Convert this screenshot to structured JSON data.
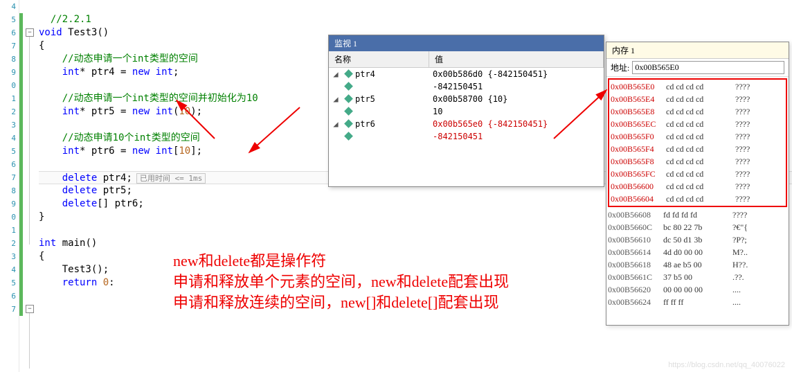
{
  "editor": {
    "line_numbers": [
      "4",
      "5",
      "6",
      "7",
      "8",
      "9",
      "0",
      "1",
      "2",
      "3",
      "4",
      "5",
      "6",
      "7",
      "8",
      "9",
      "0",
      "1",
      "2",
      "3",
      "4",
      "5",
      "6",
      "7"
    ],
    "comment_section": "//2.2.1",
    "func_decl": {
      "kw": "void",
      "name": "Test3",
      "paren": "()"
    },
    "brace_open": "{",
    "c1": "//动态申请一个",
    "c1_type": "int",
    "c1_tail": "类型的空间",
    "l1": {
      "type": "int",
      "star": "*",
      "var": "ptr4",
      "eq": " = ",
      "kw": "new",
      "sp": " ",
      "t2": "int",
      "end": ";"
    },
    "c2": "//动态申请一个",
    "c2_type": "int",
    "c2_tail": "类型的空间并初始化为10",
    "l2": {
      "type": "int",
      "star": "*",
      "var": "ptr5",
      "eq": " = ",
      "kw": "new",
      "sp": " ",
      "t2": "int",
      "lp": "(",
      "num": "10",
      "rp": ")",
      "end": ";"
    },
    "c3": "//动态申请10个",
    "c3_type": "int",
    "c3_tail": "类型的空间",
    "l3": {
      "type": "int",
      "star": "*",
      "var": "ptr6",
      "eq": " = ",
      "kw": "new",
      "sp": " ",
      "t2": "int",
      "lb": "[",
      "num": "10",
      "rb": "]",
      "end": ";"
    },
    "d1": {
      "kw": "delete",
      "sp": " ",
      "var": "ptr4",
      "end": ";"
    },
    "perf_label": "已用时间 <= 1ms",
    "d2": {
      "kw": "delete",
      "sp": " ",
      "var": "ptr5",
      "end": ";"
    },
    "d3": {
      "kw": "delete",
      "br": "[] ",
      "var": "ptr6",
      "end": ";"
    },
    "brace_close": "}",
    "main_decl": {
      "type": "int",
      "name": "main",
      "paren": "()"
    },
    "main_body_call": "Test3();",
    "main_return": {
      "kw": "return",
      "sp": " ",
      "num": "0",
      "end": ":"
    }
  },
  "watch": {
    "title": "监视 1",
    "hdr_name": "名称",
    "hdr_value": "值",
    "rows": [
      {
        "exp": "◢",
        "icon": true,
        "name": "ptr4",
        "value": "0x00b586d0 {-842150451}"
      },
      {
        "exp": "",
        "icon": true,
        "name": "",
        "value": "-842150451",
        "child": true
      },
      {
        "exp": "◢",
        "icon": true,
        "name": "ptr5",
        "value": "0x00b58700 {10}"
      },
      {
        "exp": "",
        "icon": true,
        "name": "",
        "value": "10",
        "child": true
      },
      {
        "exp": "◢",
        "icon": true,
        "name": "ptr6",
        "value": "0x00b565e0 {-842150451}",
        "red": true
      },
      {
        "exp": "",
        "icon": true,
        "name": "",
        "value": "-842150451",
        "child": true,
        "red": true
      }
    ]
  },
  "memory": {
    "title": "内存 1",
    "addr_label": "地址:",
    "addr_value": "0x00B565E0",
    "highlighted": [
      {
        "a": "0x00B565E0",
        "h": "cd cd cd cd",
        "t": "????"
      },
      {
        "a": "0x00B565E4",
        "h": "cd cd cd cd",
        "t": "????"
      },
      {
        "a": "0x00B565E8",
        "h": "cd cd cd cd",
        "t": "????"
      },
      {
        "a": "0x00B565EC",
        "h": "cd cd cd cd",
        "t": "????"
      },
      {
        "a": "0x00B565F0",
        "h": "cd cd cd cd",
        "t": "????"
      },
      {
        "a": "0x00B565F4",
        "h": "cd cd cd cd",
        "t": "????"
      },
      {
        "a": "0x00B565F8",
        "h": "cd cd cd cd",
        "t": "????"
      },
      {
        "a": "0x00B565FC",
        "h": "cd cd cd cd",
        "t": "????"
      },
      {
        "a": "0x00B56600",
        "h": "cd cd cd cd",
        "t": "????"
      },
      {
        "a": "0x00B56604",
        "h": "cd cd cd cd",
        "t": "????"
      }
    ],
    "rest": [
      {
        "a": "0x00B56608",
        "h": "fd fd fd fd",
        "t": "????"
      },
      {
        "a": "0x00B5660C",
        "h": "bc 80 22 7b",
        "t": "?€\"{"
      },
      {
        "a": "0x00B56610",
        "h": "dc 50 d1 3b",
        "t": "?P?;"
      },
      {
        "a": "0x00B56614",
        "h": "4d d0 00 00",
        "t": "M?.."
      },
      {
        "a": "0x00B56618",
        "h": "48 ae b5 00",
        "t": "H??."
      },
      {
        "a": "0x00B5661C",
        "h": "37 b5 00",
        "t": ".??."
      },
      {
        "a": "0x00B56620",
        "h": "00 00 00 00",
        "t": "...."
      },
      {
        "a": "0x00B56624",
        "h": "ff ff ff",
        "t": "...."
      }
    ]
  },
  "overlay": {
    "l1": "new和delete都是操作符",
    "l2": "申请和释放单个元素的空间，new和delete配套出现",
    "l3": "申请和释放连续的空间，new[]和delete[]配套出现"
  },
  "watermark": "https://blog.csdn.net/qq_40076022"
}
